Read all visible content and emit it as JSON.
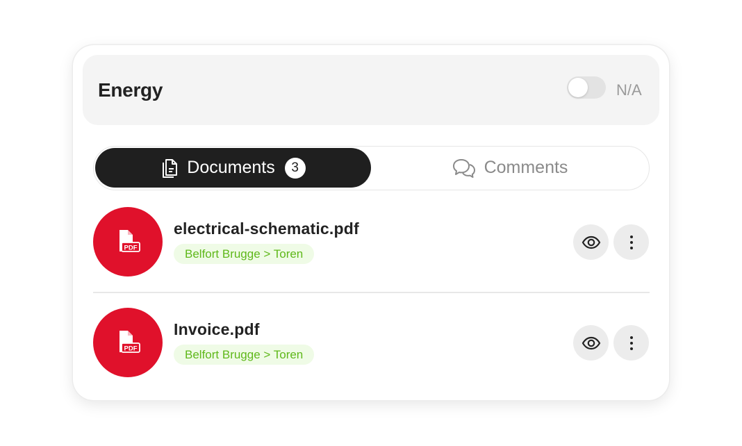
{
  "section": {
    "title": "Energy",
    "toggle_state": "off",
    "toggle_label": "N/A"
  },
  "tabs": {
    "documents": {
      "label": "Documents",
      "count": "3",
      "icon": "documents-icon",
      "active": true
    },
    "comments": {
      "label": "Comments",
      "icon": "comments-icon",
      "active": false
    }
  },
  "documents": [
    {
      "name": "electrical-schematic.pdf",
      "location": "Belfort Brugge > Toren",
      "file_icon": "pdf-file-icon"
    },
    {
      "name": "Invoice.pdf",
      "location": "Belfort Brugge > Toren",
      "file_icon": "pdf-file-icon"
    }
  ],
  "colors": {
    "pdf_icon_bg": "#e0112b",
    "active_tab_bg": "#1f1f1f",
    "tag_bg": "#effbe6",
    "tag_text": "#5fb81a"
  }
}
